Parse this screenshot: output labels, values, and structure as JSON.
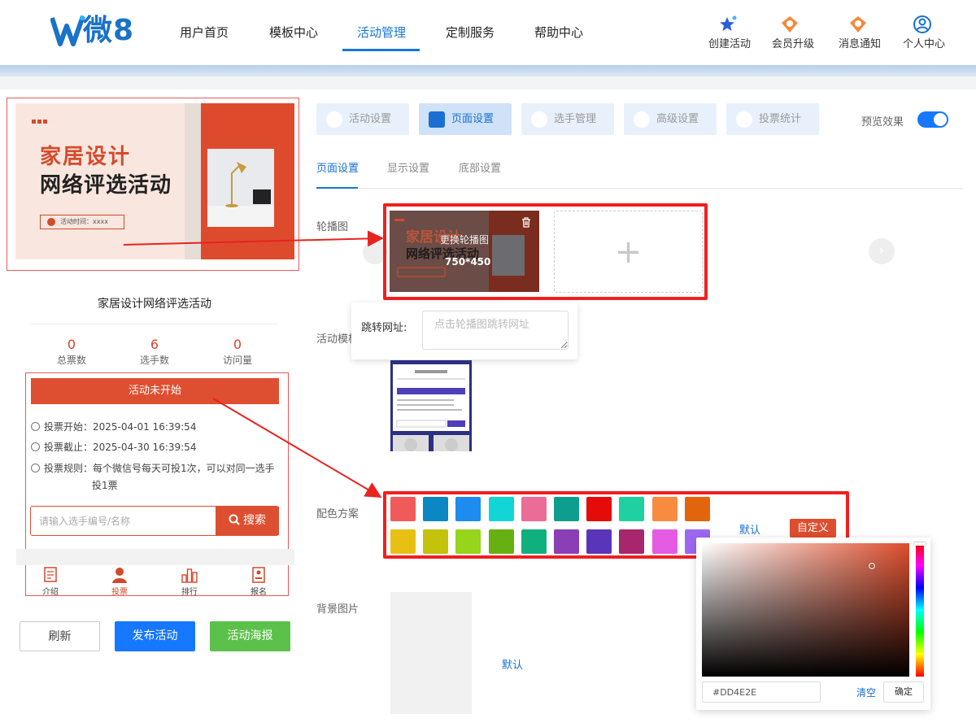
{
  "header": {
    "logo_text": "微8",
    "nav": [
      "用户首页",
      "模板中心",
      "活动管理",
      "定制服务",
      "帮助中心"
    ],
    "active_nav": "活动管理",
    "actions": [
      "创建活动",
      "会员升级",
      "消息通知",
      "个人中心"
    ]
  },
  "preview": {
    "banner_title_line1": "家居设计",
    "banner_title_line2": "网络评选活动",
    "banner_time": "活动时间：xxxx",
    "activity_title": "家居设计网络评选活动",
    "stats": [
      {
        "value": "0",
        "label": "总票数"
      },
      {
        "value": "6",
        "label": "选手数"
      },
      {
        "value": "0",
        "label": "访问量"
      }
    ],
    "status": "活动未开始",
    "vote_start": "投票开始：2025-04-01 16:39:54",
    "vote_end": "投票截止：2025-04-30 16:39:54",
    "rule_line1": "投票规则：每个微信号每天可投1次，可以对同一选手",
    "rule_line2": "投1票",
    "search_placeholder": "请输入选手编号/名称",
    "search_button": "搜索",
    "tabs": [
      "介绍",
      "投票",
      "排行",
      "报名"
    ]
  },
  "actions": {
    "refresh": "刷新",
    "publish": "发布活动",
    "poster": "活动海报"
  },
  "settings": {
    "tabs": [
      "活动设置",
      "页面设置",
      "选手管理",
      "高级设置",
      "投票统计"
    ],
    "active_tab": "页面设置",
    "preview_label": "预览效果",
    "subtabs": [
      "页面设置",
      "显示设置",
      "底部设置"
    ],
    "carousel_label": "轮播图",
    "carousel_replace": "更换轮播图",
    "carousel_size": "750*450",
    "jump_label": "跳转网址:",
    "jump_placeholder": "点击轮播图跳转网址",
    "template_label": "活动模板",
    "color_label": "配色方案",
    "default_label": "默认",
    "custom_label": "自定义",
    "bg_label": "背景图片",
    "bg_default": "默认"
  },
  "colors": {
    "row1": [
      "#f05a5a",
      "#0b87c3",
      "#1e8bf0",
      "#12d6d6",
      "#ec6c98",
      "#0e9e8f",
      "#e60b0b",
      "#1fd1a0",
      "#f98b41",
      "#e2650b"
    ],
    "row2": [
      "#e8c014",
      "#c4c20b",
      "#97d41c",
      "#67b012",
      "#10b07e",
      "#8a3fb6",
      "#5a35b9",
      "#a8266b",
      "#e35ce3",
      "#9b68f0"
    ]
  },
  "picker": {
    "hex": "#DD4E2E",
    "clear": "清空",
    "ok": "确定"
  }
}
